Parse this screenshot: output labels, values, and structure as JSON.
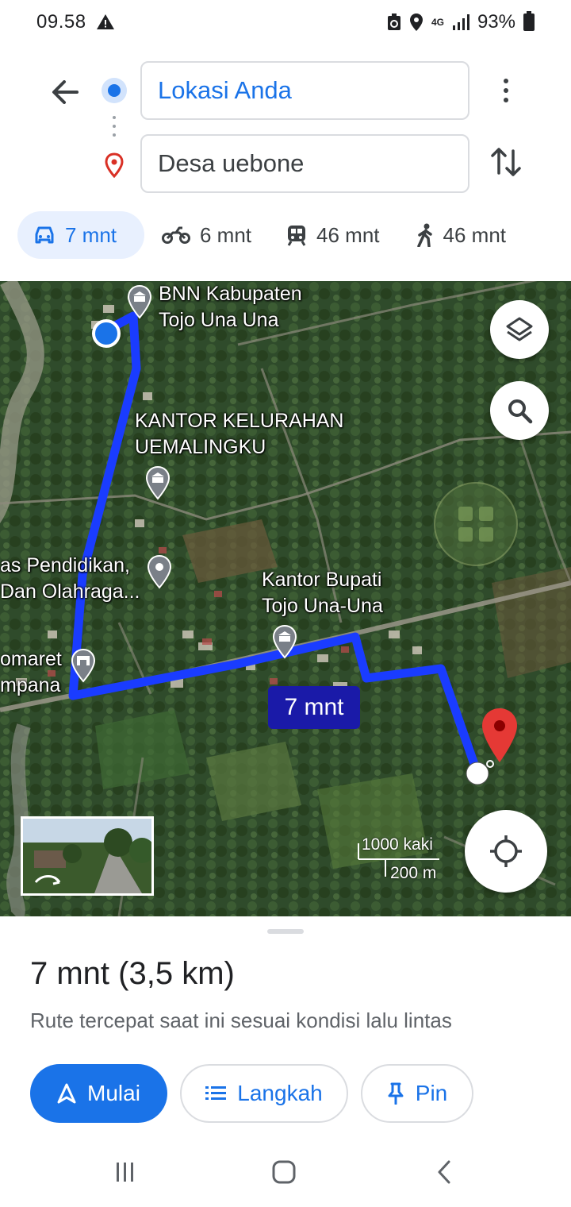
{
  "status_bar": {
    "time": "09.58",
    "network": "4G",
    "battery": "93%"
  },
  "directions": {
    "origin_value": "Lokasi Anda",
    "destination_value": "Desa uebone"
  },
  "travel_modes": [
    {
      "name": "drive",
      "icon": "car-icon",
      "label": "7 mnt",
      "selected": true
    },
    {
      "name": "motorcycle",
      "icon": "motorcycle-icon",
      "label": "6 mnt",
      "selected": false
    },
    {
      "name": "transit",
      "icon": "train-icon",
      "label": "46 mnt",
      "selected": false
    },
    {
      "name": "walk",
      "icon": "walking-icon",
      "label": "46 mnt",
      "selected": false
    }
  ],
  "map": {
    "labels": {
      "bnn": "BNN Kabupaten\nTojo Una Una",
      "kelurahan": "KANTOR KELURAHAN\nUEMALINGKU",
      "pendidikan": "as Pendidikan,\nDan Olahraga...",
      "bupati": "Kantor Bupati\nTojo Una-Una",
      "indomaret": "omaret\nmpana"
    },
    "route_duration": "7 mnt",
    "scale_imperial": "1000 kaki",
    "scale_metric": "200 m",
    "colors": {
      "route": "#1a3cff",
      "destination_pin": "#e53935",
      "origin_dot": "#1a73e8"
    }
  },
  "summary": {
    "title": "7 mnt (3,5 km)",
    "subtitle": "Rute tercepat saat ini sesuai kondisi lalu lintas"
  },
  "actions": {
    "start": "Mulai",
    "steps": "Langkah",
    "pin": "Pin"
  },
  "accent_color": "#1a73e8"
}
